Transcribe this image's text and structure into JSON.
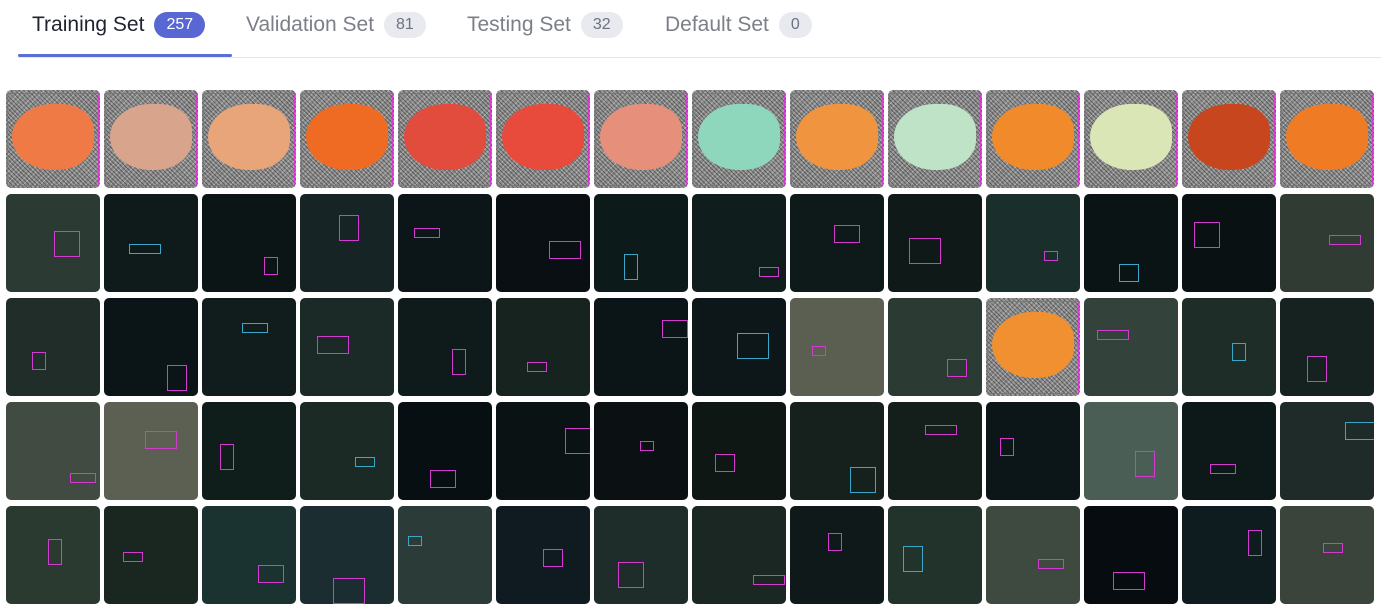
{
  "tabs": [
    {
      "label": "Training Set",
      "count": "257",
      "active": true
    },
    {
      "label": "Validation Set",
      "count": "81",
      "active": false
    },
    {
      "label": "Testing Set",
      "count": "32",
      "active": false
    },
    {
      "label": "Default Set",
      "count": "0",
      "active": false
    }
  ],
  "thumbnails": [
    {
      "bg": "noise",
      "fish": "#f07a45"
    },
    {
      "bg": "noise",
      "fish": "#d8a48c"
    },
    {
      "bg": "noise",
      "fish": "#e9a57a"
    },
    {
      "bg": "noise",
      "fish": "#ef6a22"
    },
    {
      "bg": "noise",
      "fish": "#e14c3c"
    },
    {
      "bg": "noise",
      "fish": "#e84a3b"
    },
    {
      "bg": "noise",
      "fish": "#e6907b"
    },
    {
      "bg": "noise",
      "fish": "#8ed7bd"
    },
    {
      "bg": "noise",
      "fish": "#f0943f"
    },
    {
      "bg": "noise",
      "fish": "#bfe3c6"
    },
    {
      "bg": "noise",
      "fish": "#f08a2a"
    },
    {
      "bg": "noise",
      "fish": "#dbe6b7"
    },
    {
      "bg": "noise",
      "fish": "#c8461e"
    },
    {
      "bg": "noise",
      "fish": "#f07b25"
    },
    {
      "bg": "#2b3a33"
    },
    {
      "bg": "#0f1a1a"
    },
    {
      "bg": "#0b1515"
    },
    {
      "bg": "#162426"
    },
    {
      "bg": "#0c1518"
    },
    {
      "bg": "#090f12"
    },
    {
      "bg": "#0d1a1a"
    },
    {
      "bg": "#0f1d1c"
    },
    {
      "bg": "#0d1a19"
    },
    {
      "bg": "#0f1a18"
    },
    {
      "bg": "#1a2e2c"
    },
    {
      "bg": "#0b1414"
    },
    {
      "bg": "#091112"
    },
    {
      "bg": "#303c33"
    },
    {
      "bg": "#202d28"
    },
    {
      "bg": "#0b1416"
    },
    {
      "bg": "#111c1c"
    },
    {
      "bg": "#1b2a27"
    },
    {
      "bg": "#0f1b1b"
    },
    {
      "bg": "#16231f"
    },
    {
      "bg": "#0b1417"
    },
    {
      "bg": "#0d1618"
    },
    {
      "bg": "#5a5f52"
    },
    {
      "bg": "#2b3a33"
    },
    {
      "bg": "noise",
      "fish": "#f09030"
    },
    {
      "bg": "#33423a"
    },
    {
      "bg": "#1f2d29"
    },
    {
      "bg": "#16221f"
    },
    {
      "bg": "#414b42"
    },
    {
      "bg": "#5b6053"
    },
    {
      "bg": "#0f1d1b"
    },
    {
      "bg": "#1c2a26"
    },
    {
      "bg": "#080f12"
    },
    {
      "bg": "#0a1214"
    },
    {
      "bg": "#0b1012"
    },
    {
      "bg": "#0e1714"
    },
    {
      "bg": "#16211d"
    },
    {
      "bg": "#141f1c"
    },
    {
      "bg": "#0c1618"
    },
    {
      "bg": "#4a5e55"
    },
    {
      "bg": "#0d1819"
    },
    {
      "bg": "#1f2b28"
    },
    {
      "bg": "#2a3a30"
    },
    {
      "bg": "#1a2620"
    },
    {
      "bg": "#1b3330"
    },
    {
      "bg": "#1b2d30"
    },
    {
      "bg": "#2b3b37"
    },
    {
      "bg": "#0f1b20"
    },
    {
      "bg": "#1f2d2a"
    },
    {
      "bg": "#1a2723"
    },
    {
      "bg": "#0f1919"
    },
    {
      "bg": "#22332c"
    },
    {
      "bg": "#3e4a40"
    },
    {
      "bg": "#070c10"
    },
    {
      "bg": "#0e1b1f"
    },
    {
      "bg": "#3a443b"
    }
  ]
}
